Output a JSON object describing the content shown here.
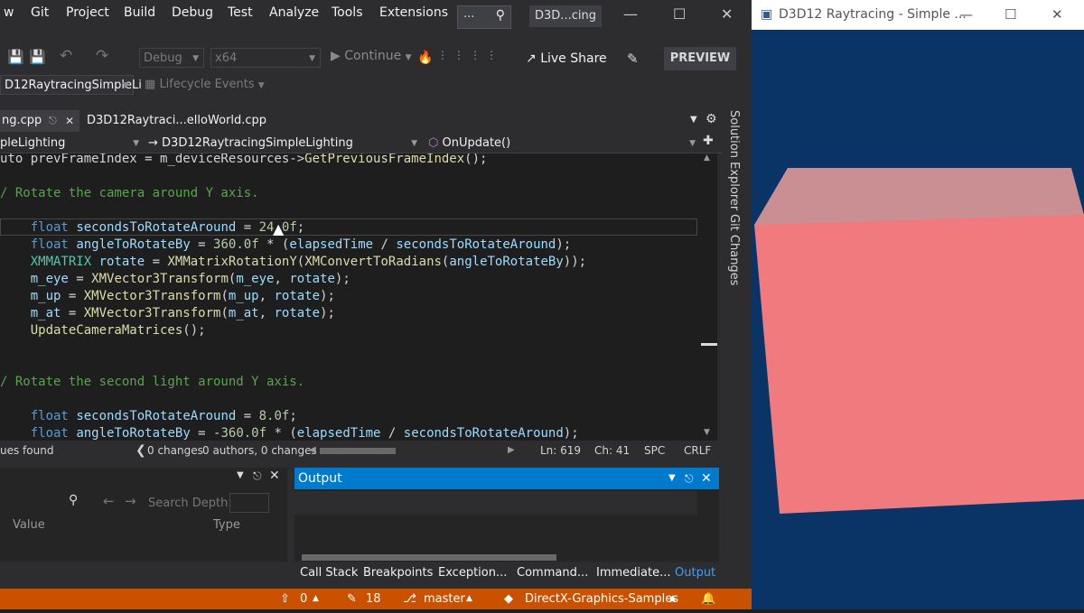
{
  "menu": [
    "w",
    "Git",
    "Project",
    "Build",
    "Debug",
    "Test",
    "Analyze",
    "Tools",
    "Extensions"
  ],
  "search": {
    "text": "...",
    "icon": "search-icon"
  },
  "solution_title": "D3D...cing",
  "toolbar": {
    "config": "Debug",
    "platform": "x64",
    "continue": "Continue",
    "live_share": "Live Share",
    "preview": "PREVIEW",
    "project": "D12RaytracingSimpleLi",
    "lifecycle": "Lifecycle Events"
  },
  "tabs": {
    "active": "ng.cpp",
    "second": "D3D12Raytraci...elloWorld.cpp"
  },
  "nav": {
    "project": "pleLighting",
    "class": "D3D12RaytracingSimpleLighting",
    "method": "OnUpdate()"
  },
  "code": [
    "uto prevFrameIndex = m_deviceResources->GetPreviousFrameIndex();",
    "",
    "/ Rotate the camera around Y axis.",
    "",
    "    float secondsToRotateAround = 24.0f;",
    "    float angleToRotateBy = 360.0f * (elapsedTime / secondsToRotateAround);",
    "    XMMATRIX rotate = XMMatrixRotationY(XMConvertToRadians(angleToRotateBy));",
    "    m_eye = XMVector3Transform(m_eye, rotate);",
    "    m_up = XMVector3Transform(m_up, rotate);",
    "    m_at = XMVector3Transform(m_at, rotate);",
    "    UpdateCameraMatrices();",
    "",
    "",
    "/ Rotate the second light around Y axis.",
    "",
    "    float secondsToRotateAround = 8.0f;",
    "    float angleToRotateBy = -360.0f * (elapsedTime / secondsToRotateAround);"
  ],
  "editor_status": {
    "issues": "ues found",
    "changes": "0 changes",
    "authors": "0 authors, 0 changes",
    "line": "Ln: 619",
    "col": "Ch: 41",
    "spc": "SPC",
    "crlf": "CRLF"
  },
  "side": {
    "solution_explorer": "Solution Explorer",
    "git_changes": "Git Changes"
  },
  "locals": {
    "search_depth": "Search Depth:",
    "col_value": "Value",
    "col_type": "Type"
  },
  "output": {
    "title": "Output"
  },
  "bottom_tabs": [
    "Call Stack",
    "Breakpoints",
    "Exception...",
    "Command...",
    "Immediate...",
    "Output"
  ],
  "statusbar": {
    "up": "0",
    "edits": "18",
    "branch": "master",
    "repo": "DirectX-Graphics-Samples"
  },
  "d3d_window": {
    "title": "D3D12 Raytracing - Simple ...",
    "background": "#0a3366",
    "cube_front": "#f07a7e",
    "cube_top": "#c98f93",
    "cube_side": "#b98c95"
  }
}
